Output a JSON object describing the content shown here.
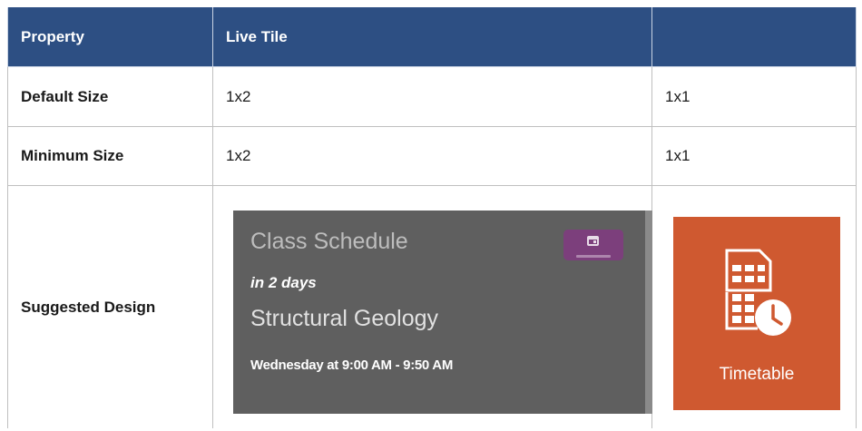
{
  "table": {
    "headers": [
      "Property",
      "Live Tile",
      ""
    ],
    "rows": [
      {
        "label": "Default Size",
        "live_tile": "1x2",
        "small_tile": "1x1"
      },
      {
        "label": "Minimum Size",
        "live_tile": "1x2",
        "small_tile": "1x1"
      },
      {
        "label": "Suggested Design"
      }
    ]
  },
  "live_tile": {
    "title": "Class Schedule",
    "due": "in 2 days",
    "course": "Structural Geology",
    "time": "Wednesday at 9:00 AM - 9:50 AM",
    "background": "#5f5f5f",
    "badge_icon": "calendar-icon",
    "badge_color": "#7c3f7c"
  },
  "small_tile": {
    "label": "Timetable",
    "icon": "timetable-clock-icon",
    "background": "#cf5930"
  },
  "colors": {
    "header_bg": "#2d4f83",
    "header_text": "#ffffff",
    "border": "#bfbfbf"
  }
}
